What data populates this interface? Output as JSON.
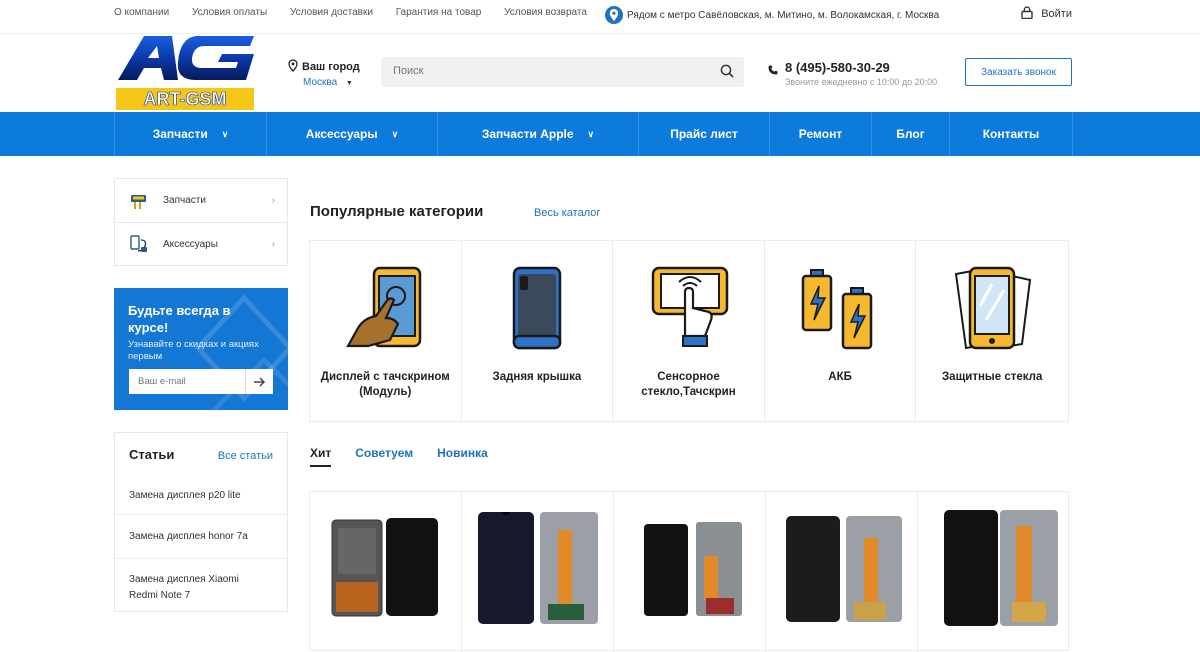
{
  "topbar": {
    "links": [
      "О компании",
      "Условия оплаты",
      "Условия доставки",
      "Гарантия на товар",
      "Условия возврата"
    ],
    "metro": "Рядом с метро Савёловская, м. Митино, м. Волокамская, г. Москва",
    "login": "Войти"
  },
  "header": {
    "logo_letters": "AG",
    "logo_text": "ART-GSM",
    "city_label": "Ваш город",
    "city_value": "Москва",
    "search_placeholder": "Поиск",
    "phone": "8 (495)-580-30-29",
    "hours": "Звоните ежедневно с 10:00 до 20:00",
    "callback": "Заказать звонок"
  },
  "nav": [
    {
      "label": "Запчасти",
      "chevron": true
    },
    {
      "label": "Аксессуары",
      "chevron": true
    },
    {
      "label": "Запчасти Apple",
      "chevron": true
    },
    {
      "label": "Прайс лист",
      "chevron": false
    },
    {
      "label": "Ремонт",
      "chevron": false
    },
    {
      "label": "Блог",
      "chevron": false
    },
    {
      "label": "Контакты",
      "chevron": false
    }
  ],
  "sidebar": {
    "categories": [
      {
        "label": "Запчасти",
        "icon": "parts-icon"
      },
      {
        "label": "Аксессуары",
        "icon": "accessories-icon"
      }
    ]
  },
  "promo": {
    "title": "Будьте всегда в курсе!",
    "text": "Узнавайте о скидках и акциях первым",
    "email_placeholder": "Ваш e-mail"
  },
  "articles": {
    "title": "Статьи",
    "all": "Все статьи",
    "items": [
      "Замена дисплея p20 lite",
      "Замена дисплея honor 7a",
      "Замена дисплея Xiaomi Redmi Note 7"
    ]
  },
  "popular": {
    "title": "Популярные категории",
    "catalog": "Весь каталог",
    "items": [
      {
        "name": "Дисплей с тачскрином (Модуль)",
        "icon": "display-touch-icon"
      },
      {
        "name": "Задняя крышка",
        "icon": "back-cover-icon"
      },
      {
        "name": "Сенсорное стекло,Тачскрин",
        "icon": "touchscreen-icon"
      },
      {
        "name": "АКБ",
        "icon": "battery-icon"
      },
      {
        "name": "Защитные стекла",
        "icon": "protective-glass-icon"
      }
    ]
  },
  "tabs": [
    "Хит",
    "Советуем",
    "Новинка"
  ],
  "colors": {
    "brand": "#0c7bdc",
    "link": "#1e73be",
    "accent": "#f5c518"
  }
}
